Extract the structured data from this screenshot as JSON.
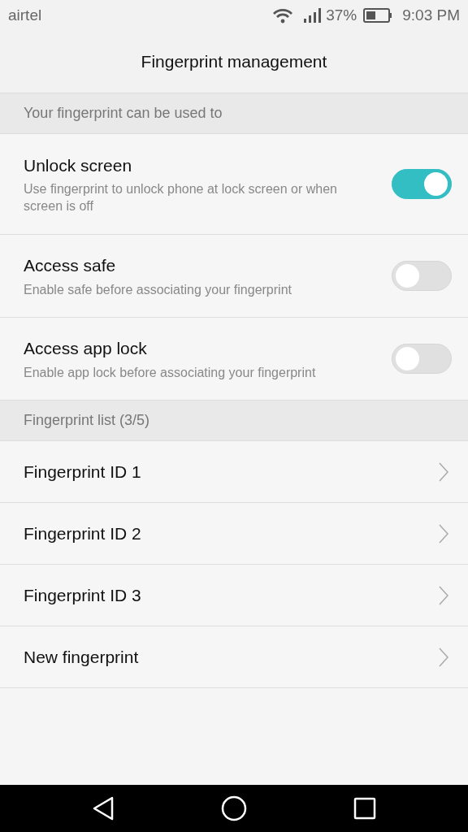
{
  "status_bar": {
    "carrier": "airtel",
    "battery": "37%",
    "time": "9:03 PM"
  },
  "title": "Fingerprint management",
  "sections": [
    {
      "header": "Your fingerprint can be used to",
      "items": [
        {
          "kind": "switch",
          "label": "Unlock screen",
          "description": "Use fingerprint to unlock phone at lock screen or when screen is off",
          "on": true
        },
        {
          "kind": "switch",
          "label": "Access safe",
          "description": "Enable safe before associating your fingerprint",
          "on": false
        },
        {
          "kind": "switch",
          "label": "Access app lock",
          "description": "Enable app lock before associating your fingerprint",
          "on": false
        }
      ]
    },
    {
      "header": "Fingerprint list (3/5)",
      "items": [
        {
          "kind": "link",
          "label": "Fingerprint ID 1"
        },
        {
          "kind": "link",
          "label": "Fingerprint ID 2"
        },
        {
          "kind": "link",
          "label": "Fingerprint ID 3"
        },
        {
          "kind": "link",
          "label": "New fingerprint"
        }
      ]
    }
  ]
}
